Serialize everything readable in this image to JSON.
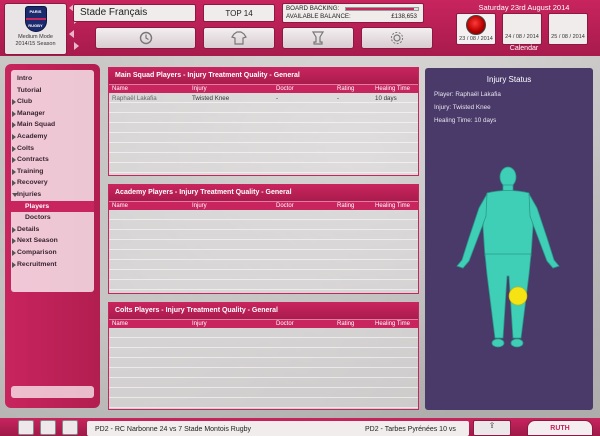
{
  "club": {
    "name": "Stade Français",
    "logo_text_top": "PARIS",
    "logo_text_bottom": "RUGBY",
    "mode": "Medium Mode",
    "season": "2014/15 Season"
  },
  "header": {
    "league": "TOP 14",
    "board_backing_label": "BOARD BACKING:",
    "board_backing_level": 0.95,
    "balance_label": "AVAILABLE BALANCE:",
    "balance_value": "£138,653"
  },
  "toolbar": {
    "icons": [
      "clock-icon",
      "kit-icon",
      "trophy-icon",
      "gear-icon"
    ]
  },
  "calendar": {
    "date": "Saturday 23rd August 2014",
    "days": [
      "23 / 08 / 2014",
      "24 / 08 / 2014",
      "25 / 08 / 2014"
    ],
    "label": "Calendar"
  },
  "sidebar": {
    "items": [
      {
        "label": "Intro",
        "kind": "plain"
      },
      {
        "label": "Tutorial",
        "kind": "plain"
      },
      {
        "label": "Club",
        "kind": "arrow"
      },
      {
        "label": "Manager",
        "kind": "arrow"
      },
      {
        "label": "Main Squad",
        "kind": "arrow"
      },
      {
        "label": "Academy",
        "kind": "arrow"
      },
      {
        "label": "Colts",
        "kind": "arrow"
      },
      {
        "label": "Contracts",
        "kind": "arrow"
      },
      {
        "label": "Training",
        "kind": "arrow"
      },
      {
        "label": "Recovery",
        "kind": "arrow"
      },
      {
        "label": "Injuries",
        "kind": "open"
      },
      {
        "label": "Players",
        "kind": "sub-selected"
      },
      {
        "label": "Doctors",
        "kind": "sub"
      },
      {
        "label": "Details",
        "kind": "arrow"
      },
      {
        "label": "Next Season",
        "kind": "arrow"
      },
      {
        "label": "Comparison",
        "kind": "arrow"
      },
      {
        "label": "Recruitment",
        "kind": "arrow"
      }
    ]
  },
  "columns": [
    "Name",
    "Injury",
    "Doctor",
    "Rating",
    "Healing Time"
  ],
  "panels": {
    "main": {
      "title": "Main Squad Players - Injury Treatment Quality - General",
      "rows": [
        {
          "name": "Raphaël Lakafia",
          "injury": "Twisted Knee",
          "doctor": "-",
          "rating": "-",
          "healing": "10 days"
        }
      ]
    },
    "academy": {
      "title": "Academy Players - Injury Treatment Quality - General",
      "rows": []
    },
    "colts": {
      "title": "Colts Players - Injury Treatment Quality - General",
      "rows": []
    }
  },
  "status": {
    "title": "Injury Status",
    "player": "Player: Raphaël Lakafia",
    "injury": "Injury: Twisted Knee",
    "healing": "Healing Time: 10 days",
    "body_color": "#3fcfb7",
    "highlight_color": "#f5e313"
  },
  "ticker": {
    "left_text": "PD2 - RC Narbonne 24 vs 7 Stade Montois Rugby",
    "right_text": "PD2 - Tarbes Pyrénées 10 vs"
  },
  "buttons": {
    "continue": "RUTH"
  }
}
